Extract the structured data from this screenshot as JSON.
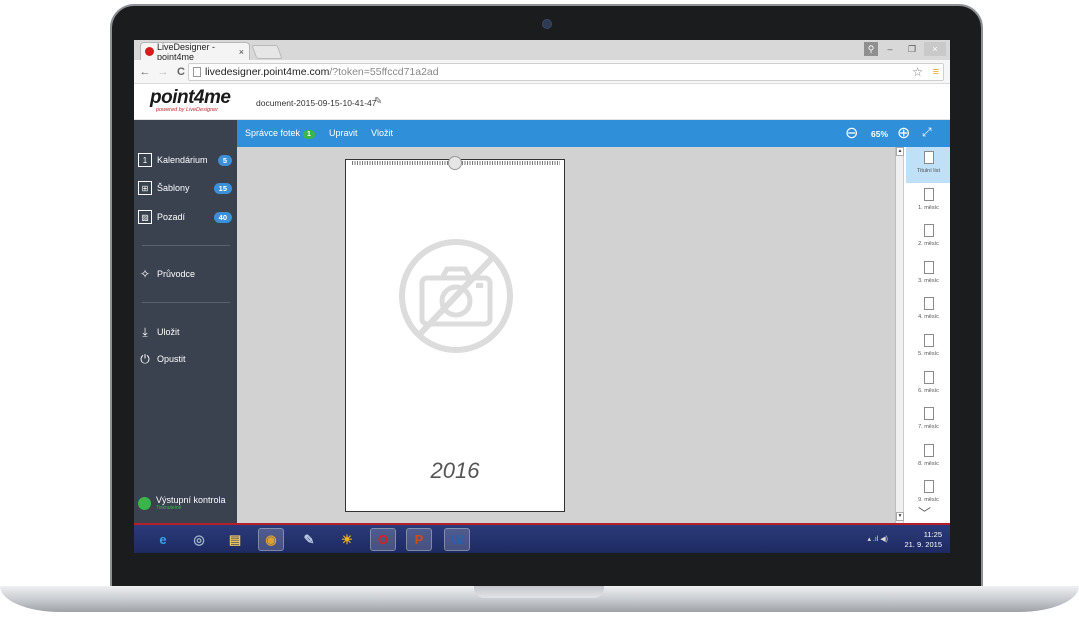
{
  "browser": {
    "tab_title": "LiveDesigner - point4me",
    "tab_close": "×",
    "url_host": "livedesigner.point4me.com",
    "url_path": "/?token=55ffccd71a2ad",
    "back": "←",
    "forward": "→",
    "reload": "C",
    "star": "☆",
    "menu": "≡",
    "window_controls": {
      "user": "⚲",
      "minimize": "–",
      "restore": "❐",
      "close": "×"
    }
  },
  "app": {
    "logo": "point4me",
    "logo_sub": "powered by LiveDesigner",
    "document_name": "document-2015-09-15-10-41-47",
    "edit_icon": "✎"
  },
  "sidebar": {
    "items": [
      {
        "label": "Kalendárium",
        "badge": "5",
        "icon": "calendar-icon",
        "glyph": "1"
      },
      {
        "label": "Šablony",
        "badge": "15",
        "icon": "layout-icon",
        "glyph": "⊞"
      },
      {
        "label": "Pozadí",
        "badge": "40",
        "icon": "image-icon",
        "glyph": "▨"
      },
      {
        "label": "Průvodce",
        "icon": "wand-icon",
        "glyph": "✧"
      },
      {
        "label": "Uložit",
        "icon": "save-icon",
        "glyph": "⤓"
      },
      {
        "label": "Opustit",
        "icon": "power-icon",
        "glyph": "⏻"
      }
    ],
    "output_check": {
      "title": "Výstupní kontrola",
      "subtitle": "Tisknutelné"
    }
  },
  "toolbar": {
    "photo_manager": "Správce fotek",
    "photo_manager_count": "1",
    "edit": "Upravit",
    "insert": "Vložit",
    "zoom": "65%",
    "zoom_out_icon": "⊖",
    "zoom_in_icon": "⊕",
    "fullscreen_icon": "⤢"
  },
  "canvas": {
    "year": "2016"
  },
  "thumbnails": [
    {
      "label": "Titulní list",
      "active": true
    },
    {
      "label": "1. měsíc"
    },
    {
      "label": "2. měsíc"
    },
    {
      "label": "3. měsíc"
    },
    {
      "label": "4. měsíc"
    },
    {
      "label": "5. měsíc"
    },
    {
      "label": "6. měsíc"
    },
    {
      "label": "7. měsíc"
    },
    {
      "label": "8. měsíc"
    },
    {
      "label": "9. měsíc"
    }
  ],
  "taskbar": {
    "apps": [
      {
        "name": "ie-icon",
        "glyph": "e",
        "color": "#3aa0e8"
      },
      {
        "name": "disk-icon",
        "glyph": "◎",
        "color": "#9fb3c8"
      },
      {
        "name": "folder-icon",
        "glyph": "▤",
        "color": "#e8c25a"
      },
      {
        "name": "chrome-icon",
        "glyph": "◉",
        "color": "#e0a030",
        "active": true
      },
      {
        "name": "paint-icon",
        "glyph": "✎",
        "color": "#b6c8e0"
      },
      {
        "name": "sun-icon",
        "glyph": "☀",
        "color": "#f0b020"
      },
      {
        "name": "opera-icon",
        "glyph": "O",
        "color": "#d9201f",
        "active": true
      },
      {
        "name": "powerpoint-icon",
        "glyph": "P",
        "color": "#d04a1c",
        "active": true
      },
      {
        "name": "word-icon",
        "glyph": "W",
        "color": "#2b5fb0",
        "active": true
      }
    ],
    "tray_icons": "▴ .ıl ◀)",
    "time": "11:25",
    "date": "21. 9. 2015"
  }
}
